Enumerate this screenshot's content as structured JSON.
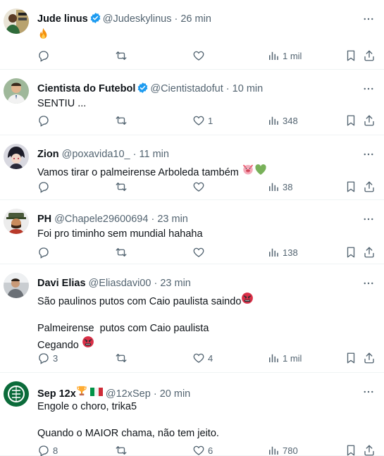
{
  "tweets": [
    {
      "name": "Jude linus",
      "verified": true,
      "handle": "@Judeskylinus",
      "dot": "·",
      "time": "26 min",
      "text": "",
      "emoji_after": "fire",
      "replies": "",
      "retweets": "",
      "likes": "",
      "views": "1 mil",
      "avatar_color": "#b8a26e"
    },
    {
      "name": "Cientista do Futebol",
      "verified": true,
      "handle": "@Cientistadofut",
      "dot": "·",
      "time": "10 min",
      "text": "SENTIU ...",
      "replies": "",
      "retweets": "",
      "likes": "1",
      "views": "348",
      "avatar_color": "#6e8c6a"
    },
    {
      "name": "Zion",
      "verified": false,
      "handle": "@poxavida10_",
      "dot": "·",
      "time": "11 min",
      "text": "Vamos tirar o palmeirense Arboleda também",
      "emoji_after": "pig-heart",
      "replies": "",
      "retweets": "",
      "likes": "",
      "views": "38",
      "avatar_color": "#3a3a4a"
    },
    {
      "name": "PH",
      "verified": false,
      "handle": "@Chapele29600694",
      "dot": "·",
      "time": "23 min",
      "text": "Foi pro timinho sem mundial hahaha",
      "replies": "",
      "retweets": "",
      "likes": "",
      "views": "138",
      "avatar_color": "#5a4a3a"
    },
    {
      "name": "Davi Elias",
      "verified": false,
      "handle": "@Eliasdavi00",
      "dot": "·",
      "time": "23 min",
      "line1": "São paulinos putos com Caio paulista saindo",
      "line2": "Palmeirense  putos com Caio paulista",
      "line3": "Cegando",
      "replies": "3",
      "retweets": "",
      "likes": "4",
      "views": "1 mil",
      "avatar_color": "#9aa0a6"
    },
    {
      "name": "Sep 12x",
      "verified": false,
      "handle": "@12xSep",
      "dot": "·",
      "time": "20 min",
      "line1": "Engole o choro, trika5",
      "line2": "Quando o MAIOR chama, não tem jeito.",
      "replies": "8",
      "retweets": "",
      "likes": "6",
      "views": "780",
      "avatar_color": "#0b6b3a"
    }
  ],
  "icons": {
    "reply": "reply-icon",
    "retweet": "retweet-icon",
    "like": "heart-icon",
    "views": "views-icon",
    "bookmark": "bookmark-icon",
    "share": "share-icon",
    "more": "more-icon",
    "verified": "verified-badge-icon"
  },
  "colors": {
    "text": "#0f1419",
    "muted": "#536471",
    "verified": "#1d9bf0",
    "divider": "#eff3f4"
  }
}
